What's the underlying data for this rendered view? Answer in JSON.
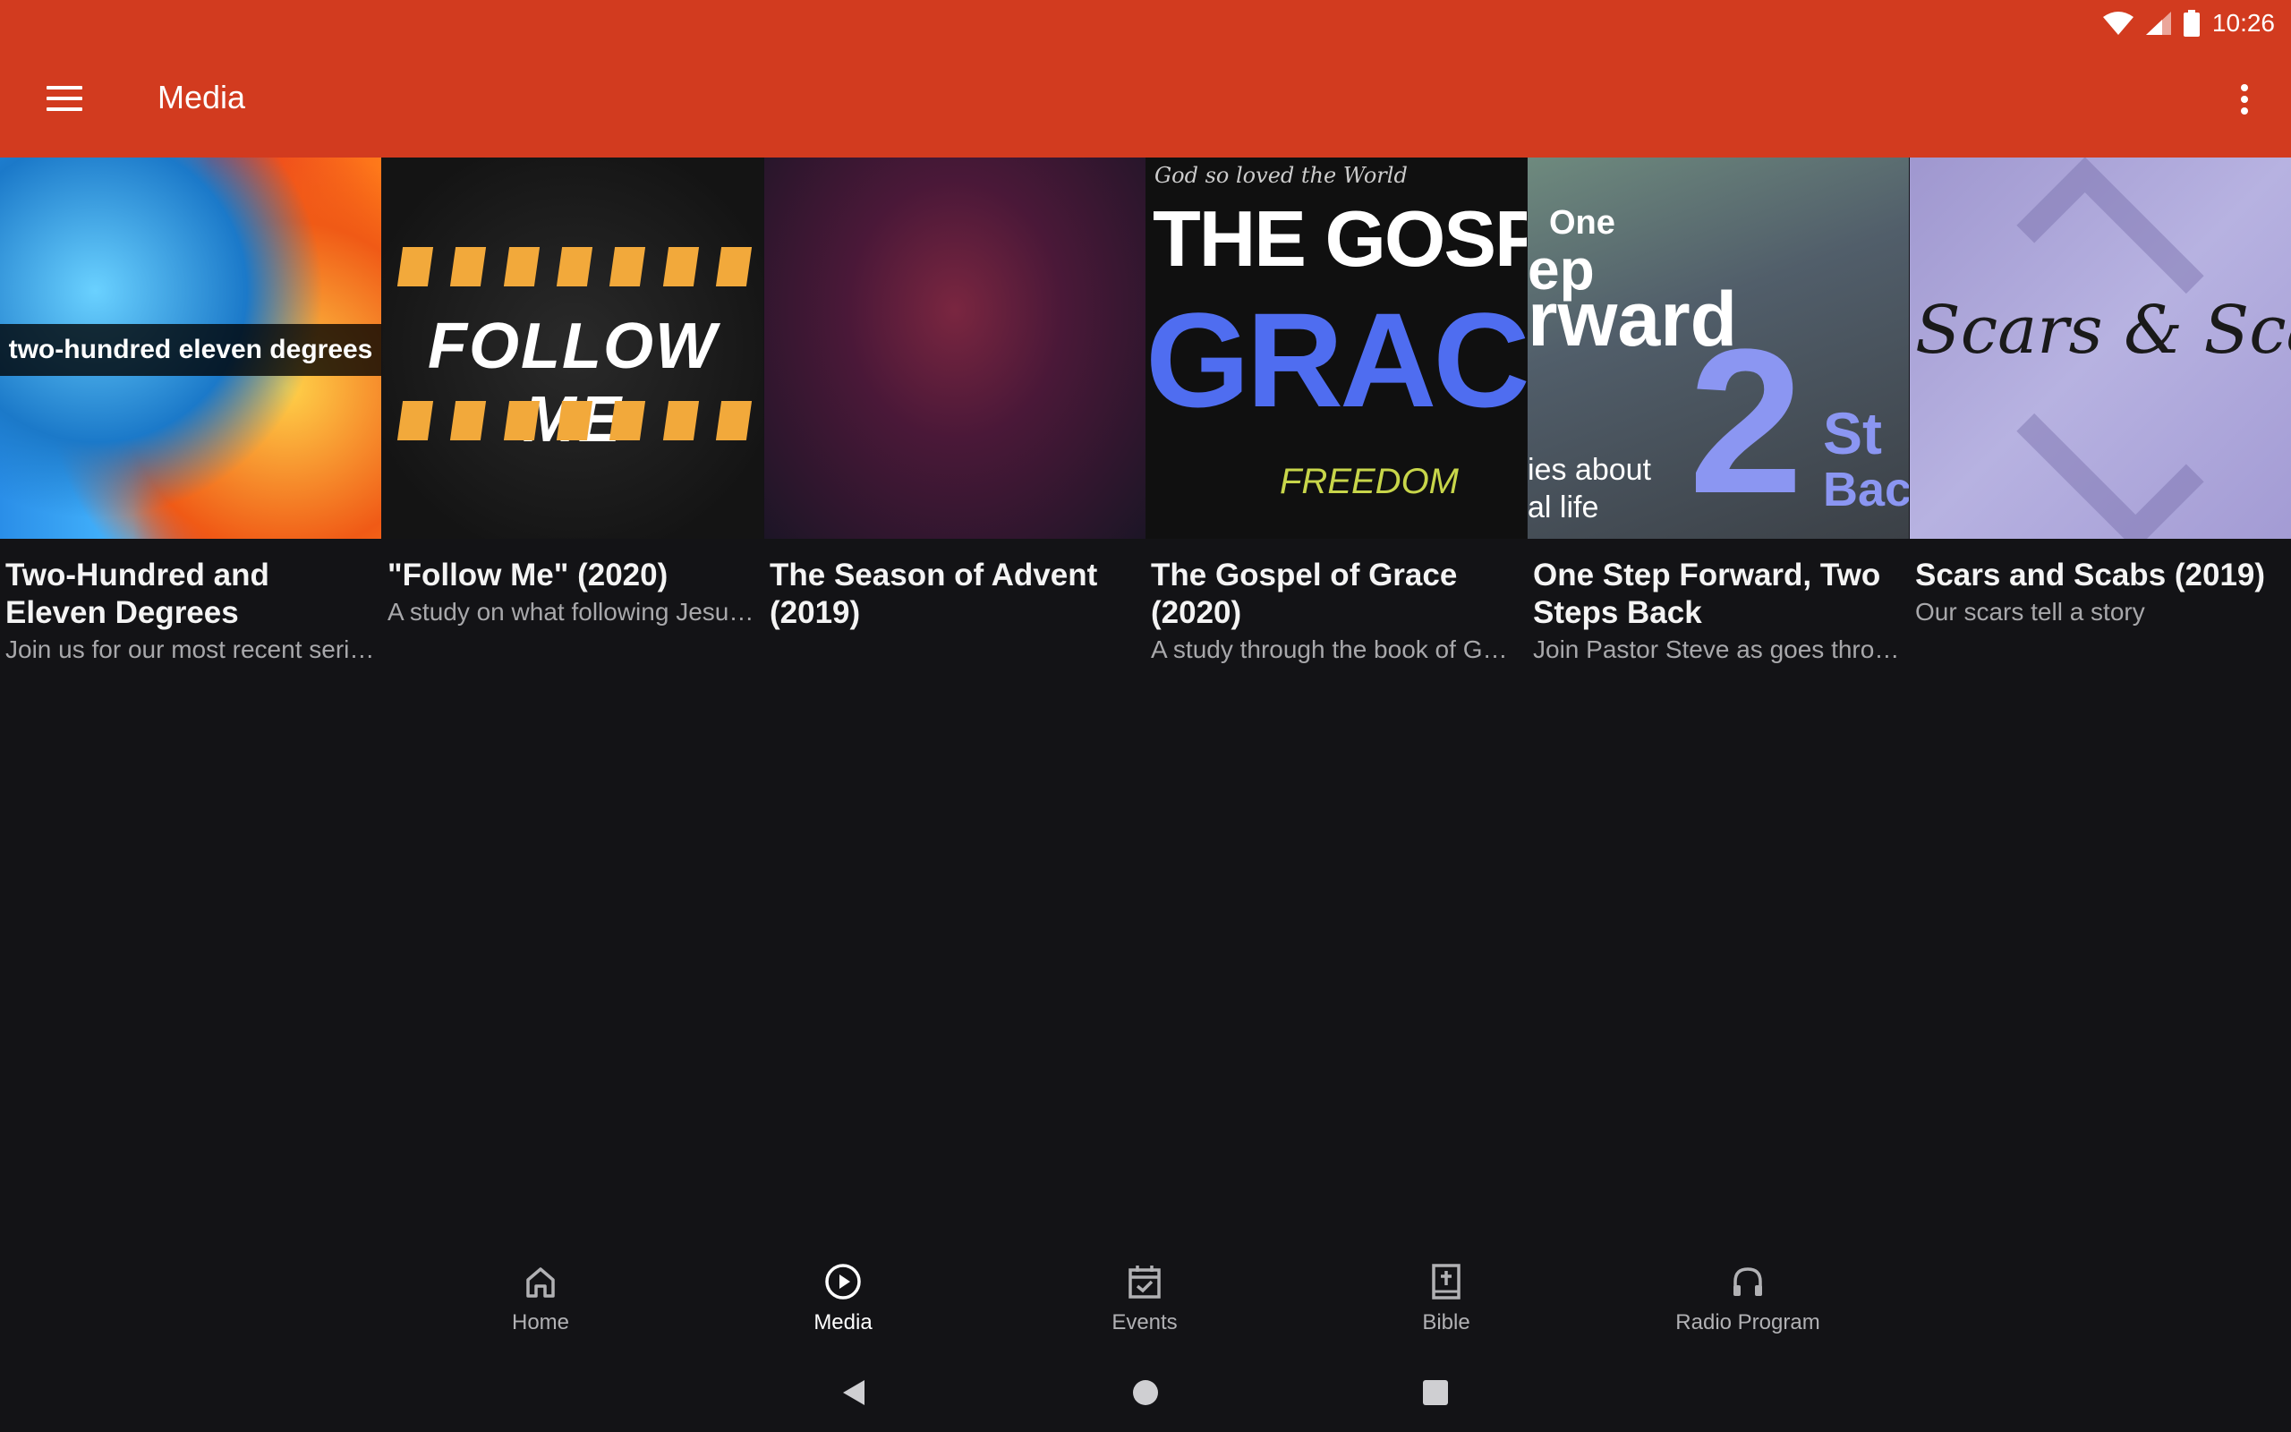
{
  "status_bar": {
    "time": "10:26"
  },
  "app_bar": {
    "title": "Media",
    "menu_icon": "menu-icon",
    "more_icon": "more-vert-icon"
  },
  "cards": [
    {
      "title": "Two-Hundred and Eleven Degrees",
      "subtitle": "Join us for our most recent seri…",
      "thumb_text": "two-hundred eleven degrees"
    },
    {
      "title": "\"Follow Me\" (2020)",
      "subtitle": "A study on what following Jesu…",
      "thumb_text": "FOLLOW ME"
    },
    {
      "title": "The Season of Advent (2019)",
      "subtitle": ""
    },
    {
      "title": "The Gospel of Grace (2020)",
      "subtitle": "A study through the book of Gal…",
      "thumb_text_1": "THE GOSPEL O",
      "thumb_text_2": "GRACE",
      "thumb_script": "God so loved the World",
      "thumb_free": "FREEDOM"
    },
    {
      "title": "One Step Forward, Two Steps Back",
      "subtitle": "Join Pastor Steve as goes throu…",
      "thumb_lines": [
        "One",
        "ep",
        "rward"
      ],
      "thumb_num": "2",
      "thumb_right_1": "St",
      "thumb_right_2": "Bac",
      "thumb_small_1": "ies about",
      "thumb_small_2": "al life"
    },
    {
      "title": "Scars and Scabs (2019)",
      "subtitle": "Our scars tell a story",
      "thumb_script": "Scars & Scabs"
    }
  ],
  "bottom_nav": [
    {
      "label": "Home",
      "icon": "home-icon",
      "active": false
    },
    {
      "label": "Media",
      "icon": "play-circle-icon",
      "active": true
    },
    {
      "label": "Events",
      "icon": "calendar-check-icon",
      "active": false
    },
    {
      "label": "Bible",
      "icon": "bible-icon",
      "active": false
    },
    {
      "label": "Radio Program",
      "icon": "headphones-icon",
      "active": false
    }
  ],
  "colors": {
    "app_bar": "#d23b1f",
    "background": "#131316",
    "grace_blue": "#4f6df0",
    "follow_orange": "#f2a93b"
  }
}
